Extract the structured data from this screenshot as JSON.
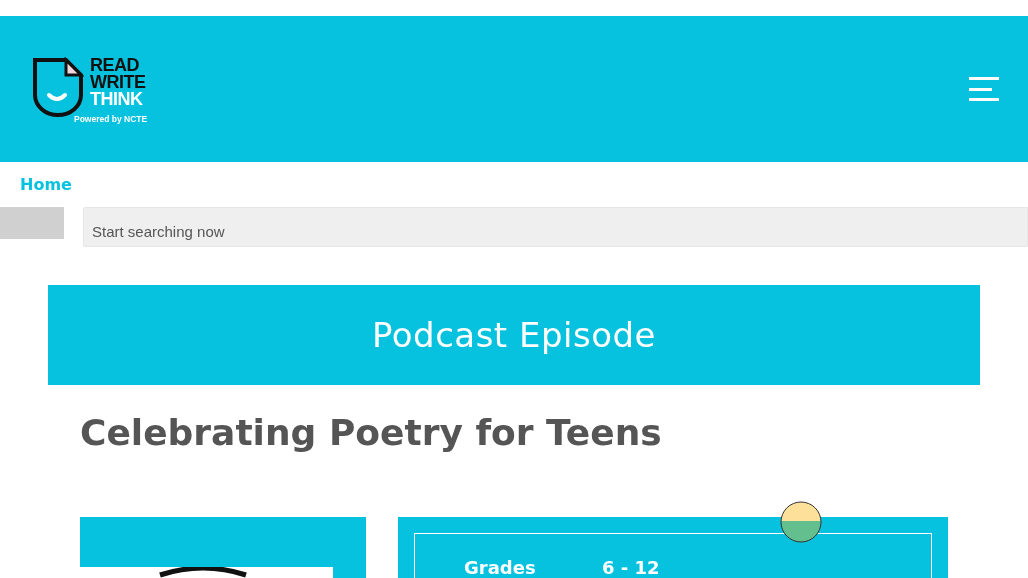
{
  "header": {
    "logo": {
      "line_1": "READ",
      "line_2": "WRITE",
      "line_3": "THINK",
      "tagline": "Powered by NCTE"
    }
  },
  "breadcrumb": [
    "Home"
  ],
  "search": {
    "placeholder": "Start searching now"
  },
  "banner": {
    "title": "Podcast Episode"
  },
  "page_title": "Celebrating Poetry for Teens",
  "details": [
    {
      "label": "Grades",
      "value": "6 - 12"
    }
  ]
}
